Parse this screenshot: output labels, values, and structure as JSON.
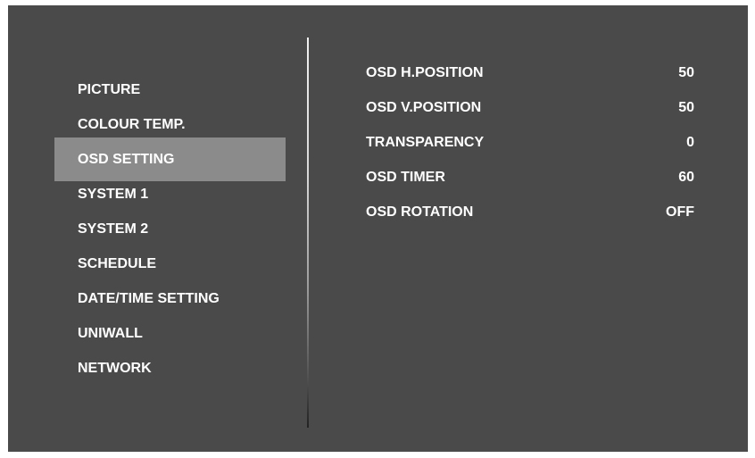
{
  "colors": {
    "background": "#4a4a4a",
    "selected_highlight": "#8b8b8b",
    "text": "#ffffff"
  },
  "menu": {
    "selected_index": 2,
    "items": [
      {
        "label": "PICTURE"
      },
      {
        "label": "COLOUR TEMP."
      },
      {
        "label": "OSD SETTING"
      },
      {
        "label": "SYSTEM 1"
      },
      {
        "label": "SYSTEM 2"
      },
      {
        "label": "SCHEDULE"
      },
      {
        "label": "DATE/TIME SETTING"
      },
      {
        "label": "UNIWALL"
      },
      {
        "label": "NETWORK"
      }
    ]
  },
  "settings": {
    "rows": [
      {
        "label": "OSD H.POSITION",
        "value": "50"
      },
      {
        "label": "OSD V.POSITION",
        "value": "50"
      },
      {
        "label": "TRANSPARENCY",
        "value": "0"
      },
      {
        "label": "OSD TIMER",
        "value": "60"
      },
      {
        "label": "OSD ROTATION",
        "value": "OFF"
      }
    ]
  }
}
